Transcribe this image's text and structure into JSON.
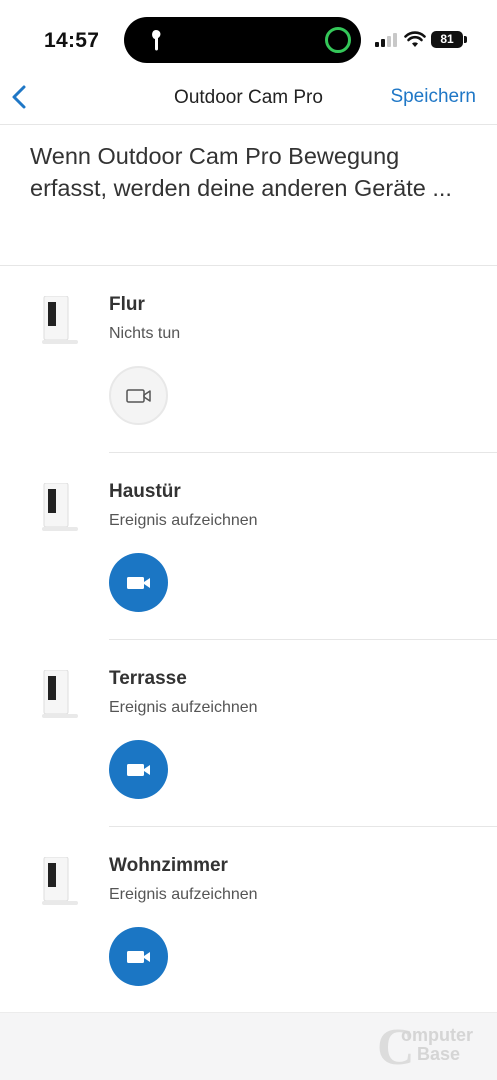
{
  "status_bar": {
    "time": "14:57",
    "battery": "81"
  },
  "nav": {
    "title": "Outdoor Cam Pro",
    "save_label": "Speichern"
  },
  "headline": "Wenn Outdoor Cam Pro Bewegung erfasst, werden deine anderen Geräte ...",
  "devices": [
    {
      "name": "Flur",
      "action": "Nichts tun",
      "record_enabled": false
    },
    {
      "name": "Haustür",
      "action": "Ereignis aufzeichnen",
      "record_enabled": true
    },
    {
      "name": "Terrasse",
      "action": "Ereignis aufzeichnen",
      "record_enabled": true
    },
    {
      "name": "Wohnzimmer",
      "action": "Ereignis aufzeichnen",
      "record_enabled": true
    }
  ],
  "watermark": {
    "line1": "omputer",
    "line2": "Base",
    "letter": "C"
  },
  "colors": {
    "accent": "#1b76c4",
    "link": "#1f77c6",
    "divider": "#e6e6e6"
  },
  "icons": {
    "back": "chevron-left-icon",
    "record": "video-camera-icon",
    "device": "indoor-camera-icon"
  }
}
